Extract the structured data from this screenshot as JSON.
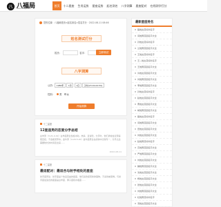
{
  "site": {
    "logo_glyph": "八",
    "logo_text": "八福局",
    "logo_domain": "www.bafuju.com"
  },
  "nav": [
    "首页",
    "十二星座",
    "生肖运势",
    "星座运势",
    "起名测名",
    "八字测算",
    "星座配对",
    "在线测字打分"
  ],
  "breadcrumb": "您的位置：八福局首页>起名测名>姓名打分 · 2022-08-11 08:46",
  "tool": {
    "title": "姓名测试打分",
    "surname_label": "姓氏：",
    "name_label": "名字：",
    "submit_label": "立即测试",
    "bazi_title": "八字测算",
    "birth_label": "公历：",
    "year": "1980年",
    "month": "1月",
    "day": "1日",
    "hour": "子时(23:00-00:59)",
    "gender_label": "性别：",
    "gender_options": [
      "男",
      "女"
    ],
    "bazi_submit": "开始测算"
  },
  "articles": [
    {
      "category": "十二星座",
      "title": "12星座男的恋爱分手总结",
      "text": "白羊男（3.21-4.19）白羊座男生性格冲动，热情、爱冒险，分手时，他们通常会表现得很直接，不会拖泥带水。金牛男（4.20-5.20）金牛座男生在感情中比较专一，分手之后需要较长的时间走出来……",
      "date": "2022-08-11"
    },
    {
      "category": "十二星座",
      "title": "最适配对：最适合与射手相处的星座",
      "text": "射手座男生：射手座是个热爱自由的星座，他们喜欢探索新鲜事物，不喜欢被束缚。与射手座最适合的星座是白羊座、狮子座和水瓶座……",
      "date": "2022-08-11"
    }
  ],
  "sidebar": {
    "title": "最新星座姓名",
    "items": [
      "路姓女孩好听名字",
      "闫姓男孩起名字大全",
      "孙姓女孩好听名字",
      "兰姓男孩起名字大全",
      "王姓女孩好听名字",
      "王—姓女孩好听名字",
      "王姓男孩起名字大全",
      "许姓女孩起名字大全",
      "刘姓男孩起名字大全",
      "李姓男孩起名字大全",
      "孙姓女孩好听名字",
      "赵姓女孩起名字大全",
      "曹姓女孩起名字大全",
      "胡姓男孩起名字大全",
      "路姓女孩好听名字",
      "闫姓男孩起名字大全",
      "田姓女孩起名字大全",
      "刘姓女孩起名字大全",
      "赵姓男孩好听名字",
      "高姓男孩起名字大全",
      "严姓男孩起名字大全",
      "刘姓女孩起名字大全",
      "魏姓男孩起名字大全",
      "沈姓女孩起名字大全",
      "杨姓女孩起名字大全",
      "张姓女孩起名字大全",
      "刘姓男孩起名字大全",
      "杜姓男孩好听名字",
      "汤姓女孩起名字大全"
    ]
  }
}
